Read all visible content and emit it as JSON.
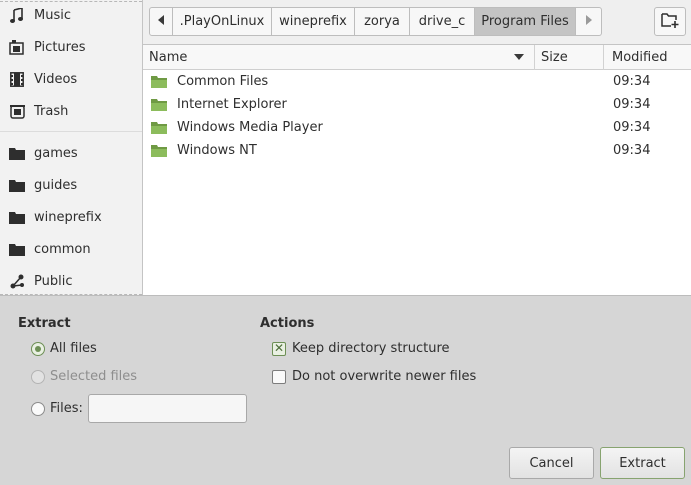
{
  "sidebar": {
    "places": [
      {
        "label": "Music",
        "icon": "music-icon"
      },
      {
        "label": "Pictures",
        "icon": "pictures-icon"
      },
      {
        "label": "Videos",
        "icon": "videos-icon"
      },
      {
        "label": "Trash",
        "icon": "trash-icon"
      }
    ],
    "bookmarks": [
      {
        "label": "games",
        "icon": "folder-icon"
      },
      {
        "label": "guides",
        "icon": "folder-icon"
      },
      {
        "label": "wineprefix",
        "icon": "folder-icon"
      },
      {
        "label": "common",
        "icon": "folder-icon"
      },
      {
        "label": "Public",
        "icon": "share-icon"
      }
    ]
  },
  "pathbar": {
    "crumbs": [
      ".PlayOnLinux",
      "wineprefix",
      "zorya",
      "drive_c",
      "Program Files"
    ],
    "active": "Program Files"
  },
  "columns": {
    "name": "Name",
    "size": "Size",
    "modified": "Modified"
  },
  "files": [
    {
      "name": "Common Files",
      "modified": "09:34"
    },
    {
      "name": "Internet Explorer",
      "modified": "09:34"
    },
    {
      "name": "Windows Media Player",
      "modified": "09:34"
    },
    {
      "name": "Windows NT",
      "modified": "09:34"
    }
  ],
  "extract": {
    "heading": "Extract",
    "all_files": "All files",
    "selected_files": "Selected files",
    "files": "Files:",
    "files_value": ""
  },
  "actions": {
    "heading": "Actions",
    "keep_structure": "Keep directory structure",
    "no_overwrite": "Do not overwrite newer files"
  },
  "buttons": {
    "cancel": "Cancel",
    "extract": "Extract"
  },
  "colors": {
    "accent": "#6d8f55",
    "folder": "#7fae4f"
  }
}
